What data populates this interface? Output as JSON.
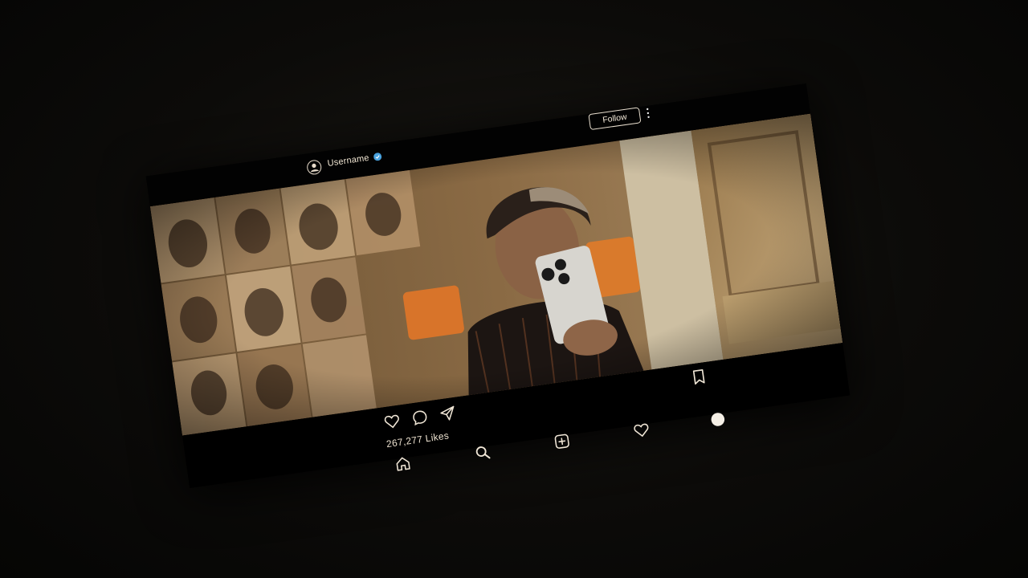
{
  "post": {
    "username": "Username",
    "verified": true,
    "follow_label": "Follow",
    "likes_label": "267,277 Likes"
  },
  "icons": {
    "avatar": "user-circle-icon",
    "verified": "verified-badge-icon",
    "more": "more-vertical-icon",
    "like": "heart-icon",
    "comment": "comment-bubble-icon",
    "share": "paper-plane-icon",
    "save": "bookmark-icon",
    "nav": [
      "home-icon",
      "search-icon",
      "add-post-icon",
      "heart-icon",
      "profile-dot-icon"
    ]
  },
  "colors": {
    "text": "#f1e6d3",
    "verified": "#4aa3df",
    "background": "#000000"
  }
}
